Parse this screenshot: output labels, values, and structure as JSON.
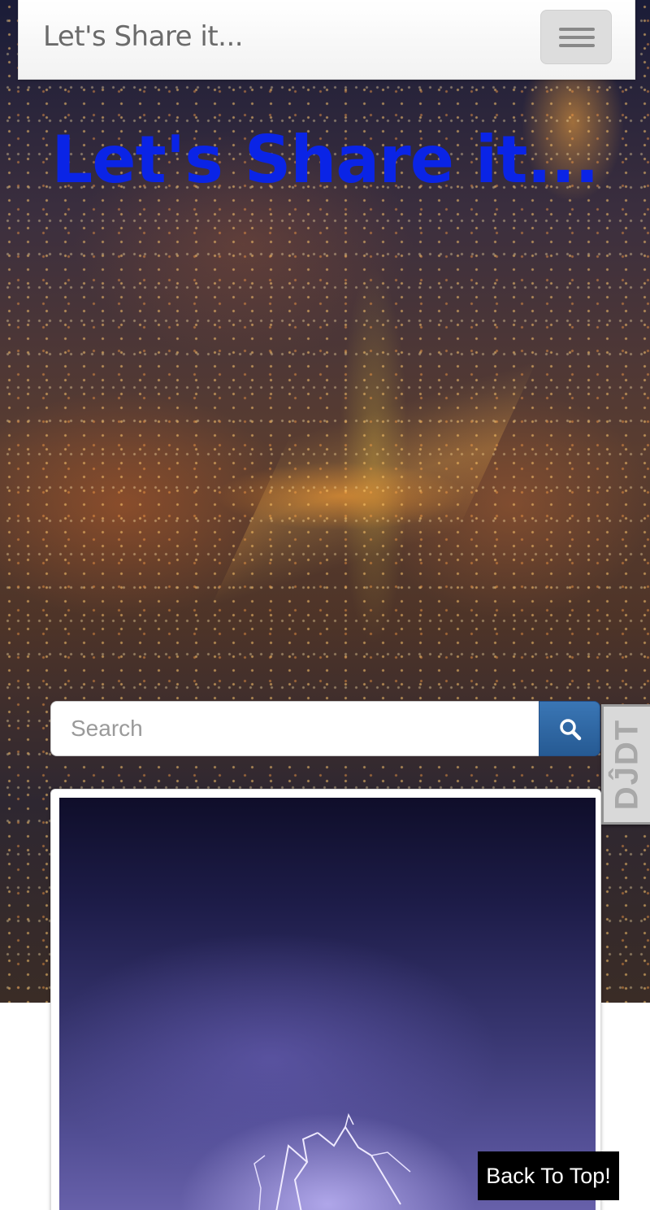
{
  "navbar": {
    "brand": "Let's Share it...",
    "menu_toggle_icon": "hamburger-menu-icon"
  },
  "hero": {
    "title": "Let's Share it...",
    "title_color": "#0a24e6"
  },
  "search": {
    "placeholder": "Search",
    "value": "",
    "button_icon": "search-icon",
    "button_color": "#2e6aa8"
  },
  "side_badge": {
    "text": "DĴDT"
  },
  "back_to_top": {
    "label": "Back To Top!"
  }
}
